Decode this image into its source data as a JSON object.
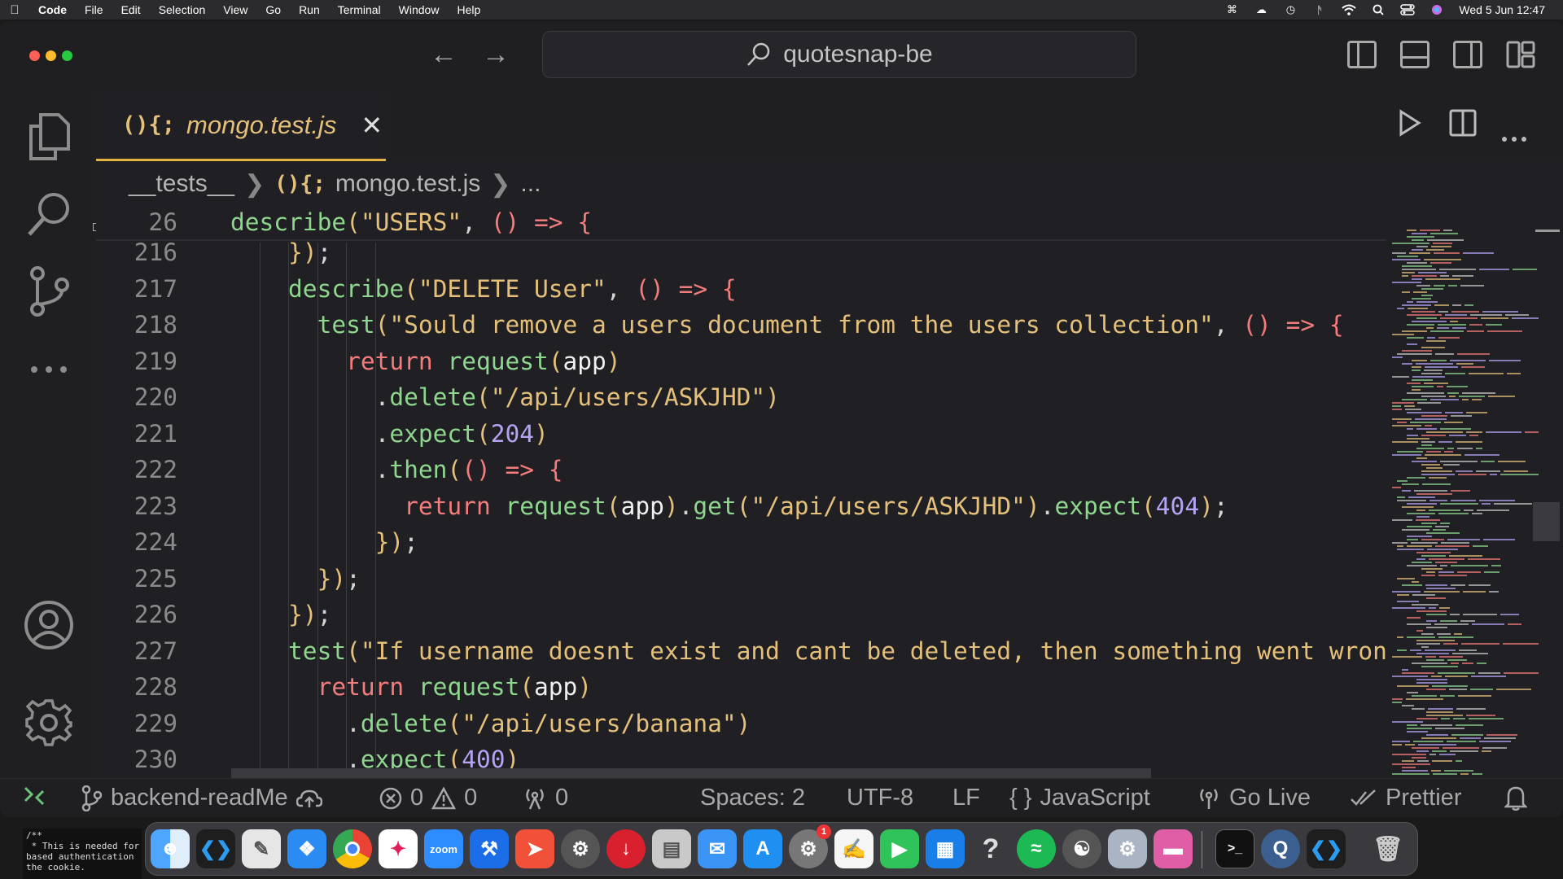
{
  "menubar": {
    "app": "Code",
    "items": [
      "File",
      "Edit",
      "Selection",
      "View",
      "Go",
      "Run",
      "Terminal",
      "Window",
      "Help"
    ],
    "datetime": "Wed 5 Jun  12:47"
  },
  "titlebar": {
    "search": "quotesnap-be"
  },
  "tab": {
    "icon": "(){;",
    "name": "mongo.test.js"
  },
  "breadcrumb": {
    "folder": "__tests__",
    "file": "mongo.test.js",
    "more": "..."
  },
  "code": {
    "sticky": {
      "ln": "26",
      "text": "describe(\"USERS\", () => {"
    },
    "lines": [
      {
        "ln": "216",
        "text": "    });"
      },
      {
        "ln": "217",
        "text": "    describe(\"DELETE User\", () => {"
      },
      {
        "ln": "218",
        "text": "      test(\"Sould remove a users document from the users collection\", () => {"
      },
      {
        "ln": "219",
        "text": "        return request(app)"
      },
      {
        "ln": "220",
        "text": "          .delete(\"/api/users/ASKJHD\")"
      },
      {
        "ln": "221",
        "text": "          .expect(204)"
      },
      {
        "ln": "222",
        "text": "          .then(() => {"
      },
      {
        "ln": "223",
        "text": "            return request(app).get(\"/api/users/ASKJHD\").expect(404);"
      },
      {
        "ln": "224",
        "text": "          });"
      },
      {
        "ln": "225",
        "text": "      });"
      },
      {
        "ln": "226",
        "text": "    });"
      },
      {
        "ln": "227",
        "text": "    test(\"If username doesnt exist and cant be deleted, then something went wrong"
      },
      {
        "ln": "228",
        "text": "      return request(app)"
      },
      {
        "ln": "229",
        "text": "        .delete(\"/api/users/banana\")"
      },
      {
        "ln": "230",
        "text": "        .expect(400)"
      }
    ]
  },
  "statusbar": {
    "branch": "backend-readMe",
    "errors": "0",
    "warnings": "0",
    "ports": "0",
    "spaces": "Spaces: 2",
    "encoding": "UTF-8",
    "eol": "LF",
    "language": "JavaScript",
    "golive": "Go Live",
    "prettier": "Prettier"
  },
  "dock": {
    "zoom_label": "zoom",
    "settings_badge": "1"
  },
  "terminal_peek": "/**\n * This is needed for\nbased authentication\nthe cookie."
}
